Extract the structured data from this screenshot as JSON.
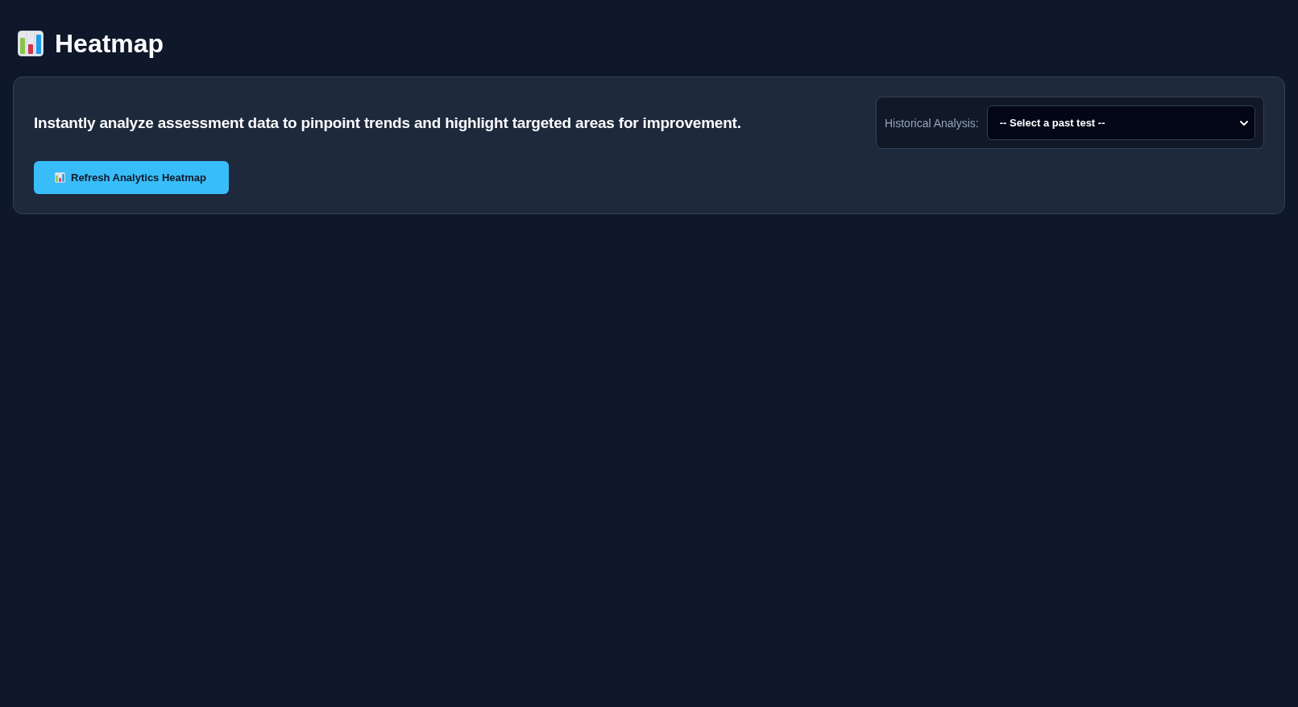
{
  "page": {
    "title": "Heatmap"
  },
  "panel": {
    "description": "Instantly analyze assessment data to pinpoint trends and highlight targeted areas for improvement.",
    "historical_analysis": {
      "label": "Historical Analysis:",
      "value": "-- Select a past test --"
    },
    "refresh_button": {
      "label": "Refresh Analytics Heatmap"
    }
  }
}
